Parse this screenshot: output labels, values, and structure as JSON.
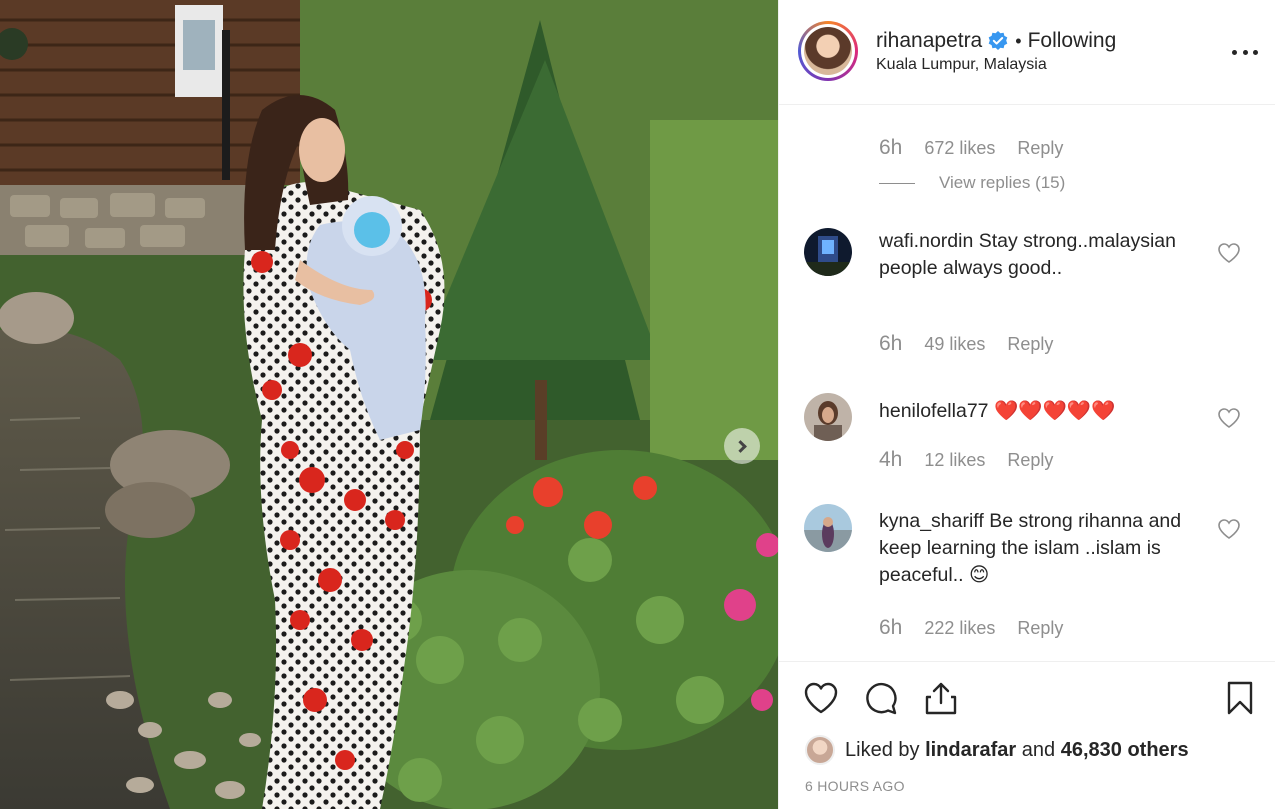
{
  "post": {
    "username": "rihanapetra",
    "separator": "•",
    "follow_status": "Following",
    "location": "Kuala Lumpur, Malaysia"
  },
  "top_comment_meta": {
    "time": "6h",
    "likes": "672 likes",
    "reply": "Reply",
    "view_replies": "View replies (15)"
  },
  "comments": [
    {
      "username": "wafi.nordin",
      "text": "Stay strong..malaysian people always good..",
      "time": "6h",
      "likes": "49 likes",
      "reply": "Reply"
    },
    {
      "username": "henilofella77",
      "text": "❤️❤️❤️❤️❤️",
      "time": "4h",
      "likes": "12 likes",
      "reply": "Reply"
    },
    {
      "username": "kyna_shariff",
      "text": "Be strong rihanna and keep learning the islam ..islam is peaceful.. 😊",
      "time": "6h",
      "likes": "222 likes",
      "reply": "Reply"
    }
  ],
  "likes_summary": {
    "prefix": "Liked by",
    "user": "lindarafar",
    "middle": "and",
    "others": "46,830 others"
  },
  "posted_ago": "6 HOURS AGO",
  "icons": {
    "verified": "verified-badge-icon",
    "more": "more-options-icon",
    "like": "heart-icon",
    "comment": "comment-icon",
    "share": "share-icon",
    "save": "bookmark-icon",
    "carousel": "chevron-right-icon"
  },
  "colors": {
    "text": "#262626",
    "muted": "#8e8e8e",
    "verified": "#3897f0",
    "border": "#efefef"
  }
}
